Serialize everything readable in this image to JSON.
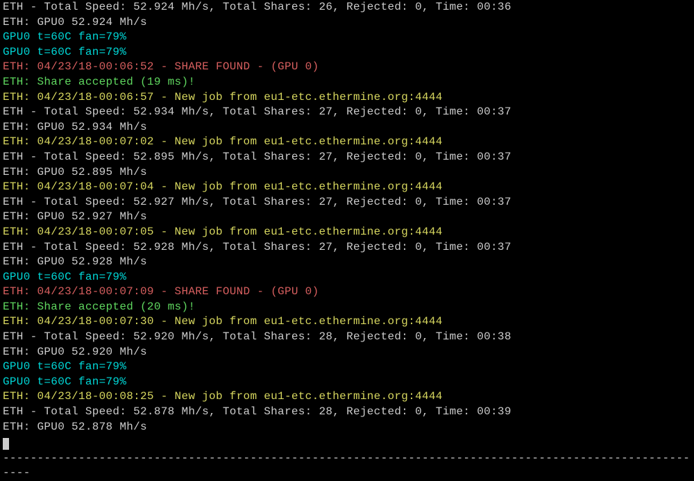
{
  "lines": [
    {
      "color": "white",
      "text": "ETH - Total Speed: 52.924 Mh/s, Total Shares: 26, Rejected: 0, Time: 00:36"
    },
    {
      "color": "white",
      "text": "ETH: GPU0 52.924 Mh/s"
    },
    {
      "color": "cyan",
      "text": "GPU0 t=60C fan=79%"
    },
    {
      "color": "cyan",
      "text": "GPU0 t=60C fan=79%"
    },
    {
      "color": "red",
      "text": "ETH: 04/23/18-00:06:52 - SHARE FOUND - (GPU 0)"
    },
    {
      "color": "green",
      "text": "ETH: Share accepted (19 ms)!"
    },
    {
      "color": "yellow",
      "text": "ETH: 04/23/18-00:06:57 - New job from eu1-etc.ethermine.org:4444"
    },
    {
      "color": "white",
      "text": "ETH - Total Speed: 52.934 Mh/s, Total Shares: 27, Rejected: 0, Time: 00:37"
    },
    {
      "color": "white",
      "text": "ETH: GPU0 52.934 Mh/s"
    },
    {
      "color": "yellow",
      "text": "ETH: 04/23/18-00:07:02 - New job from eu1-etc.ethermine.org:4444"
    },
    {
      "color": "white",
      "text": "ETH - Total Speed: 52.895 Mh/s, Total Shares: 27, Rejected: 0, Time: 00:37"
    },
    {
      "color": "white",
      "text": "ETH: GPU0 52.895 Mh/s"
    },
    {
      "color": "yellow",
      "text": "ETH: 04/23/18-00:07:04 - New job from eu1-etc.ethermine.org:4444"
    },
    {
      "color": "white",
      "text": "ETH - Total Speed: 52.927 Mh/s, Total Shares: 27, Rejected: 0, Time: 00:37"
    },
    {
      "color": "white",
      "text": "ETH: GPU0 52.927 Mh/s"
    },
    {
      "color": "yellow",
      "text": "ETH: 04/23/18-00:07:05 - New job from eu1-etc.ethermine.org:4444"
    },
    {
      "color": "white",
      "text": "ETH - Total Speed: 52.928 Mh/s, Total Shares: 27, Rejected: 0, Time: 00:37"
    },
    {
      "color": "white",
      "text": "ETH: GPU0 52.928 Mh/s"
    },
    {
      "color": "cyan",
      "text": "GPU0 t=60C fan=79%"
    },
    {
      "color": "red",
      "text": "ETH: 04/23/18-00:07:09 - SHARE FOUND - (GPU 0)"
    },
    {
      "color": "green",
      "text": "ETH: Share accepted (20 ms)!"
    },
    {
      "color": "yellow",
      "text": "ETH: 04/23/18-00:07:30 - New job from eu1-etc.ethermine.org:4444"
    },
    {
      "color": "white",
      "text": "ETH - Total Speed: 52.920 Mh/s, Total Shares: 28, Rejected: 0, Time: 00:38"
    },
    {
      "color": "white",
      "text": "ETH: GPU0 52.920 Mh/s"
    },
    {
      "color": "cyan",
      "text": "GPU0 t=60C fan=79%"
    },
    {
      "color": "cyan",
      "text": "GPU0 t=60C fan=79%"
    },
    {
      "color": "yellow",
      "text": "ETH: 04/23/18-00:08:25 - New job from eu1-etc.ethermine.org:4444"
    },
    {
      "color": "white",
      "text": "ETH - Total Speed: 52.878 Mh/s, Total Shares: 28, Rejected: 0, Time: 00:39"
    },
    {
      "color": "white",
      "text": "ETH: GPU0 52.878 Mh/s"
    }
  ],
  "dashes": " --------------------------------------------------------------------------------------------------------"
}
